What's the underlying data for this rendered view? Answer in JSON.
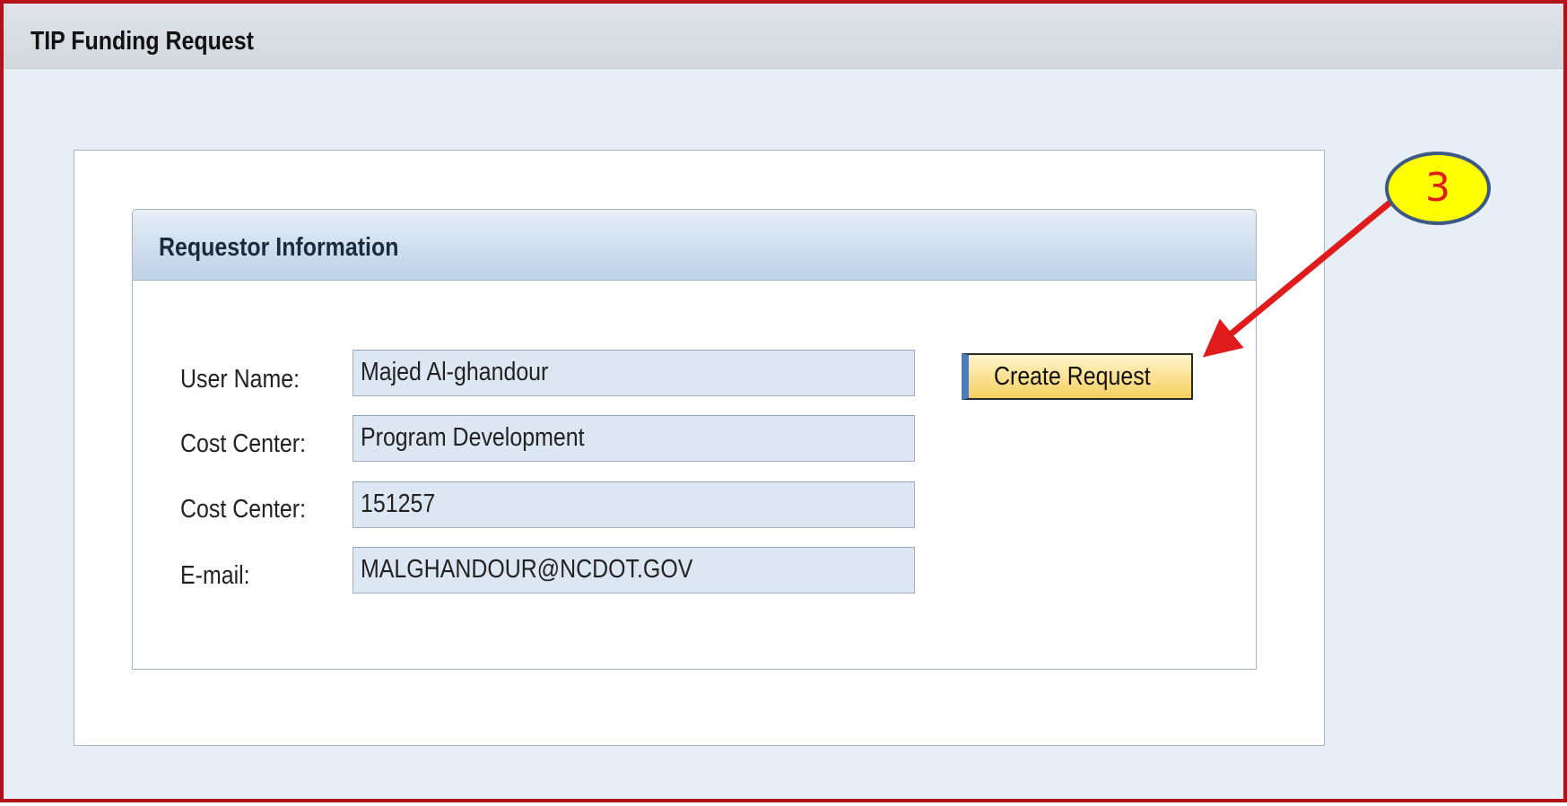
{
  "window": {
    "title": "TIP Funding Request"
  },
  "requestor_section": {
    "title": "Requestor Information",
    "fields": [
      {
        "label": "User Name:",
        "value": "Majed Al-ghandour"
      },
      {
        "label": "Cost Center:",
        "value": "Program Development"
      },
      {
        "label": "Cost Center:",
        "value": "151257"
      },
      {
        "label": "E-mail:",
        "value": "MALGHANDOUR@NCDOT.GOV"
      }
    ],
    "create_button_label": "Create Request"
  },
  "annotation": {
    "step_number": "3",
    "badge_fill": "#ffff00",
    "badge_text_color": "#e01b1b",
    "arrow_color": "#e01b1b"
  },
  "colors": {
    "frame_border": "#b3121a",
    "field_background": "#dde7f3",
    "button_fill": "#fbe08f"
  }
}
